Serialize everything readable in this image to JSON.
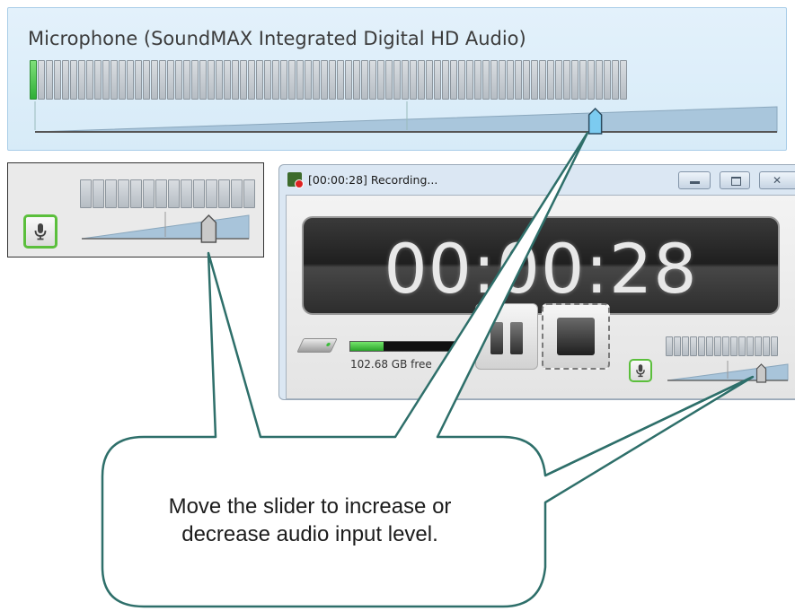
{
  "microphone_panel": {
    "title": "Microphone (SoundMAX Integrated Digital HD Audio)",
    "meter_segments": 74,
    "meter_active_segments": 1,
    "slider_level": 0.755
  },
  "small_mic_panel": {
    "mic_icon": "microphone-icon",
    "meter_segments": 14,
    "slider_level": 0.76
  },
  "recording_window": {
    "title": "[00:00:28] Recording...",
    "title_icon": "recording-app-icon",
    "timer": "00:00:28",
    "disk_free": "102.68 GB free",
    "disk_used_fraction": 0.28,
    "pause_icon": "pause-icon",
    "stop_icon": "stop-icon",
    "mic_icon": "microphone-icon",
    "meter_segments": 14,
    "slider_level": 0.78,
    "window_buttons": [
      "minimize-icon",
      "maximize-icon",
      "close-icon"
    ],
    "close_glyph": "✕"
  },
  "callout": {
    "text_line1": "Move the slider to increase or",
    "text_line2": "decrease audio input level.",
    "stroke_color": "#2e6f6a"
  },
  "colors": {
    "panel_bg": "#dbecf8",
    "meter_active": "#3cb64a",
    "mic_button_border": "#5bbf3c",
    "slider_thumb": "#7ccbf0"
  }
}
